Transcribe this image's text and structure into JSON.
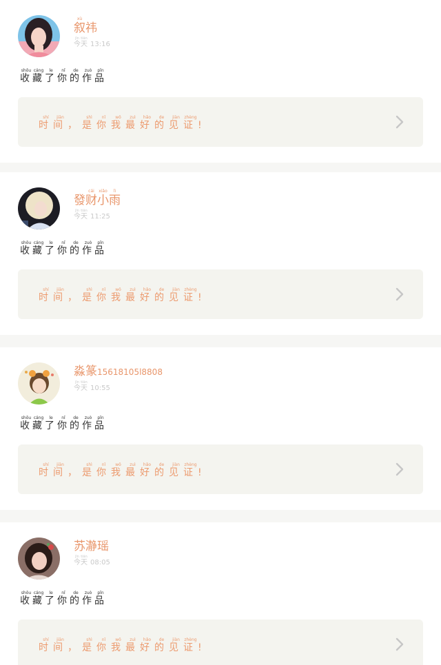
{
  "feed": {
    "items": [
      {
        "username_chars": [
          {
            "c": "叙",
            "p": "xù"
          },
          {
            "c": "祎",
            "p": ""
          }
        ],
        "username_suffix": "",
        "day_chars": [
          {
            "c": "今",
            "p": "jīn"
          },
          {
            "c": "天",
            "p": "tiān"
          }
        ],
        "time": "13:16",
        "avatar": "woman-with-dark-hair-avatar"
      },
      {
        "username_chars": [
          {
            "c": "發",
            "p": ""
          },
          {
            "c": "财",
            "p": "cái"
          },
          {
            "c": "小",
            "p": "xiǎo"
          },
          {
            "c": "雨",
            "p": "lì"
          }
        ],
        "username_suffix": "",
        "day_chars": [
          {
            "c": "今",
            "p": "jīn"
          },
          {
            "c": "天",
            "p": "tiān"
          }
        ],
        "time": "11:25",
        "avatar": "blonde-woman-avatar"
      },
      {
        "username_chars": [
          {
            "c": "淼",
            "p": ""
          },
          {
            "c": "篆",
            "p": ""
          }
        ],
        "username_suffix": "15618105l8808",
        "day_chars": [
          {
            "c": "今",
            "p": "jīn"
          },
          {
            "c": "天",
            "p": "tiān"
          }
        ],
        "time": "10:55",
        "avatar": "cartoon-girl-avatar"
      },
      {
        "username_chars": [
          {
            "c": "苏",
            "p": ""
          },
          {
            "c": "瀞",
            "p": ""
          },
          {
            "c": "瑶",
            "p": ""
          }
        ],
        "username_suffix": "",
        "day_chars": [
          {
            "c": "今",
            "p": "jīn"
          },
          {
            "c": "天",
            "p": "tiān"
          }
        ],
        "time": "08:05",
        "avatar": "woman-portrait-avatar"
      }
    ],
    "action_chars": [
      {
        "c": "收",
        "p": "shōu"
      },
      {
        "c": "藏",
        "p": "cáng"
      },
      {
        "c": "了",
        "p": "le"
      },
      {
        "c": "你",
        "p": "nǐ"
      },
      {
        "c": "的",
        "p": "de"
      },
      {
        "c": "作",
        "p": "zuò"
      },
      {
        "c": "品",
        "p": "pǐn"
      }
    ],
    "quote_chars": [
      {
        "c": "时",
        "p": "shí"
      },
      {
        "c": "间",
        "p": "jiān"
      },
      {
        "c": "，",
        "p": ""
      },
      {
        "c": "是",
        "p": "shì"
      },
      {
        "c": "你",
        "p": "nǐ"
      },
      {
        "c": "我",
        "p": "wǒ"
      },
      {
        "c": "最",
        "p": "zuì"
      },
      {
        "c": "好",
        "p": "hǎo"
      },
      {
        "c": "的",
        "p": "de"
      },
      {
        "c": "见",
        "p": "jiàn"
      },
      {
        "c": "证",
        "p": "zhèng"
      },
      {
        "c": "!",
        "p": ""
      }
    ],
    "colors": {
      "accent": "#e8956a",
      "quote_bg": "#f4f4ef",
      "separator": "#f6f6f4",
      "meta": "#c9c9c9",
      "body_text": "#333333"
    }
  }
}
